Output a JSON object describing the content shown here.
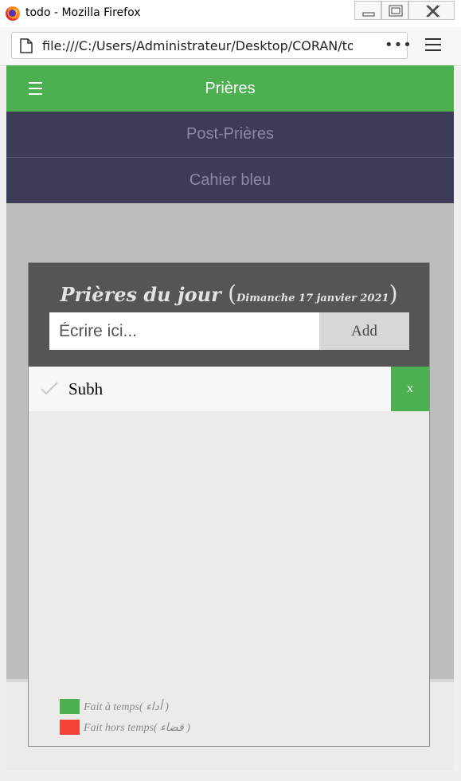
{
  "window": {
    "title": "todo - Mozilla Firefox",
    "url": "file:///C:/Users/Administrateur/Desktop/CORAN/todo/in",
    "more_label": "•••"
  },
  "app": {
    "nav_title": "Prières",
    "menu": [
      {
        "label": "Post-Prières"
      },
      {
        "label": "Cahier bleu"
      }
    ],
    "card": {
      "title_main": "Prières du jour",
      "title_date": "Dimanche 17 janvier 2021",
      "input_placeholder": "Écrire ici...",
      "add_label": "Add",
      "todos": [
        {
          "text": "Subh",
          "delete_label": "x",
          "done": false
        }
      ],
      "legend": [
        {
          "label": "Fait à temps( أداء )",
          "color": "#4caf50"
        },
        {
          "label": "Fait hors temps( قضاء )",
          "color": "#f44336"
        }
      ]
    }
  },
  "colors": {
    "accent": "#4caf50",
    "menu_bg": "#3c3b58",
    "late": "#f44336"
  }
}
